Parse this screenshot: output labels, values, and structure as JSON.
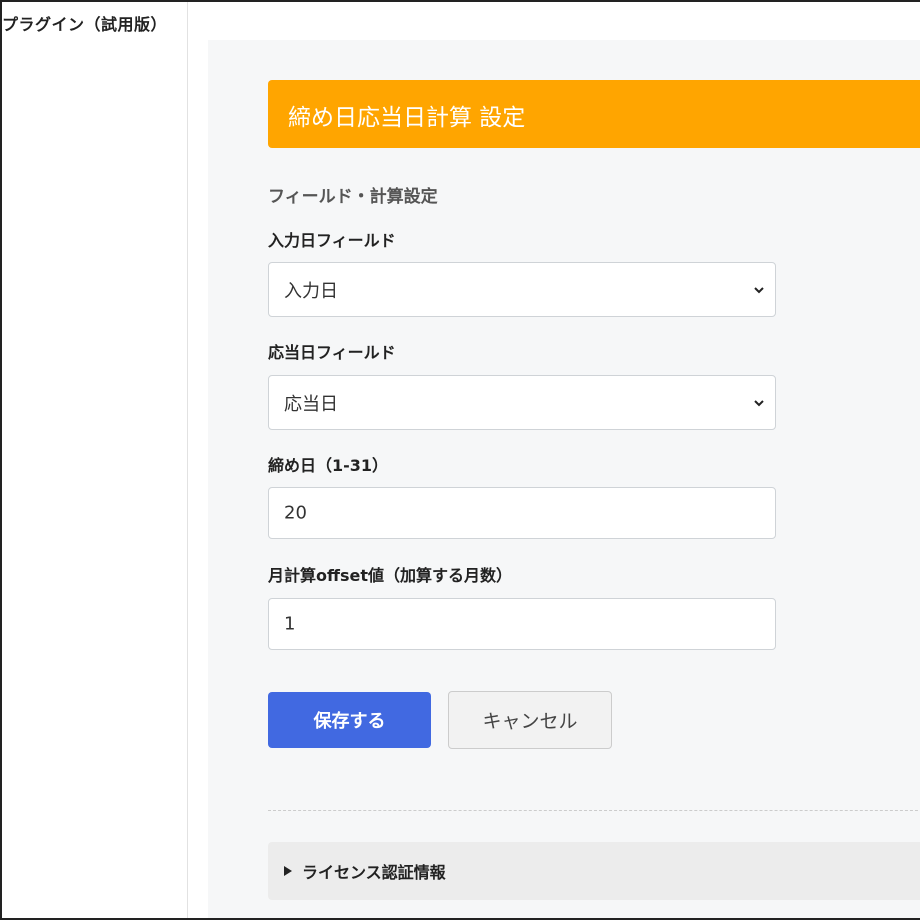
{
  "sidebar": {
    "title": "プラグイン（試用版）"
  },
  "header": {
    "title": "締め日応当日計算 設定"
  },
  "form": {
    "section_title": "フィールド・計算設定",
    "input_date_field": {
      "label": "入力日フィールド",
      "selected": "入力日"
    },
    "due_date_field": {
      "label": "応当日フィールド",
      "selected": "応当日"
    },
    "closing_day": {
      "label": "締め日（1-31）",
      "value": "20"
    },
    "month_offset": {
      "label": "月計算offset値（加算する月数）",
      "value": "1"
    },
    "save_label": "保存する",
    "cancel_label": "キャンセル"
  },
  "license": {
    "label": "ライセンス認証情報"
  },
  "icons": {
    "select_chevron": "chevron-down-icon",
    "disclosure": "triangle-right-icon"
  },
  "colors": {
    "header_bg": "#ffa500",
    "save_button_bg": "#4169e1",
    "content_bg": "#f6f7f8"
  }
}
